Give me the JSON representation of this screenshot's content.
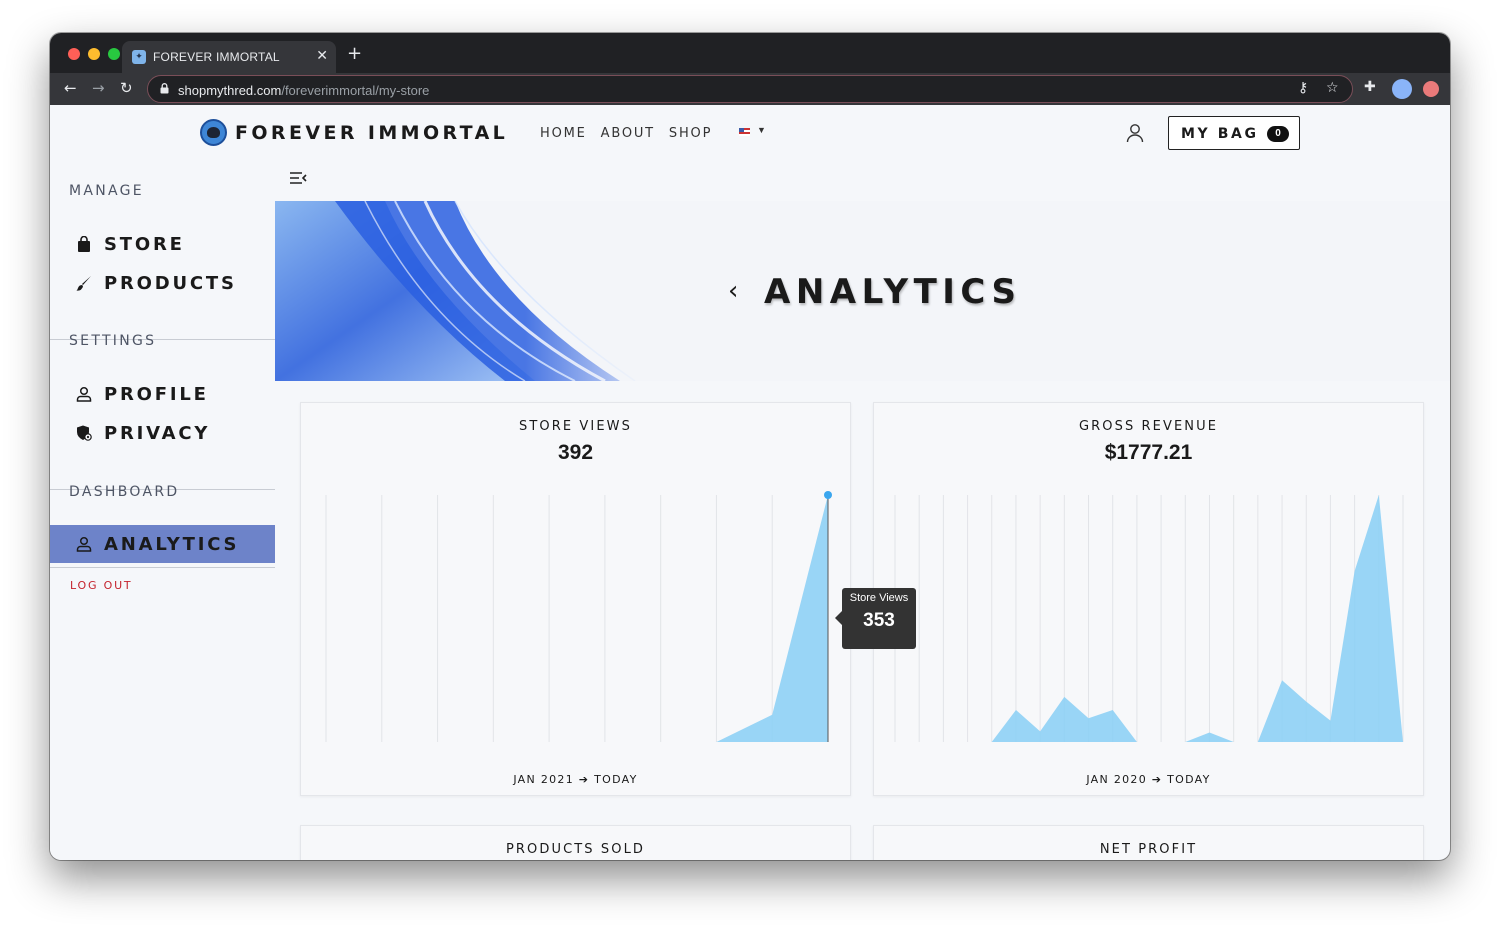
{
  "browser": {
    "tab_title": "FOREVER IMMORTAL",
    "url_host": "shopmythred.com",
    "url_path": "/foreverimmortal/my-store",
    "traffic_light_colors": [
      "#ff5f57",
      "#febc2e",
      "#28c840"
    ],
    "icons": [
      "back-arrow-icon",
      "forward-arrow-icon",
      "reload-icon",
      "lock-icon",
      "key-icon",
      "star-icon",
      "puzzle-icon"
    ]
  },
  "header": {
    "brand": "FOREVER IMMORTAL",
    "nav": [
      "HOME",
      "ABOUT",
      "SHOP"
    ],
    "bag_label": "MY BAG",
    "bag_count": "0"
  },
  "sidebar": {
    "sections": [
      {
        "heading": "MANAGE",
        "items": [
          {
            "label": "STORE",
            "icon": "bag-icon"
          },
          {
            "label": "PRODUCTS",
            "icon": "brush-icon"
          }
        ]
      },
      {
        "heading": "SETTINGS",
        "items": [
          {
            "label": "PROFILE",
            "icon": "user-icon"
          },
          {
            "label": "PRIVACY",
            "icon": "shield-icon"
          }
        ]
      },
      {
        "heading": "DASHBOARD",
        "items": [
          {
            "label": "ANALYTICS",
            "icon": "user-icon",
            "active": true
          }
        ]
      }
    ],
    "logout": "LOG OUT",
    "active_color": "#6d83c9"
  },
  "hero": {
    "title": "ANALYTICS"
  },
  "cards": {
    "store_views": {
      "title": "STORE VIEWS",
      "value": "392",
      "range": "JAN 2021 ➔ TODAY"
    },
    "gross_revenue": {
      "title": "GROSS REVENUE",
      "value": "$1777.21",
      "range": "JAN 2020 ➔ TODAY"
    },
    "products_sold": {
      "title": "PRODUCTS SOLD"
    },
    "net_profit": {
      "title": "NET PROFIT"
    }
  },
  "tooltip": {
    "label": "Store Views",
    "value": "353"
  },
  "chart_data": [
    {
      "type": "area",
      "title": "STORE VIEWS",
      "x": [
        0,
        1,
        2,
        3,
        4,
        5,
        6,
        7,
        8,
        9
      ],
      "values": [
        0,
        0,
        0,
        0,
        0,
        0,
        0,
        0,
        39,
        353
      ],
      "ylim": [
        0,
        353
      ],
      "grid": true,
      "color": "#8ed0f5",
      "highlight_index": 9
    },
    {
      "type": "area",
      "title": "GROSS REVENUE",
      "x": [
        0,
        1,
        2,
        3,
        4,
        5,
        6,
        7,
        8,
        9,
        10,
        11,
        12,
        13,
        14,
        15,
        16,
        17,
        18,
        19,
        20,
        21
      ],
      "values": [
        0,
        0,
        0,
        0,
        0,
        135,
        45,
        190,
        100,
        135,
        0,
        0,
        0,
        40,
        0,
        0,
        260,
        170,
        90,
        720,
        1040,
        0
      ],
      "ylim": [
        0,
        1040
      ],
      "grid": true,
      "color": "#8ed0f5"
    }
  ]
}
